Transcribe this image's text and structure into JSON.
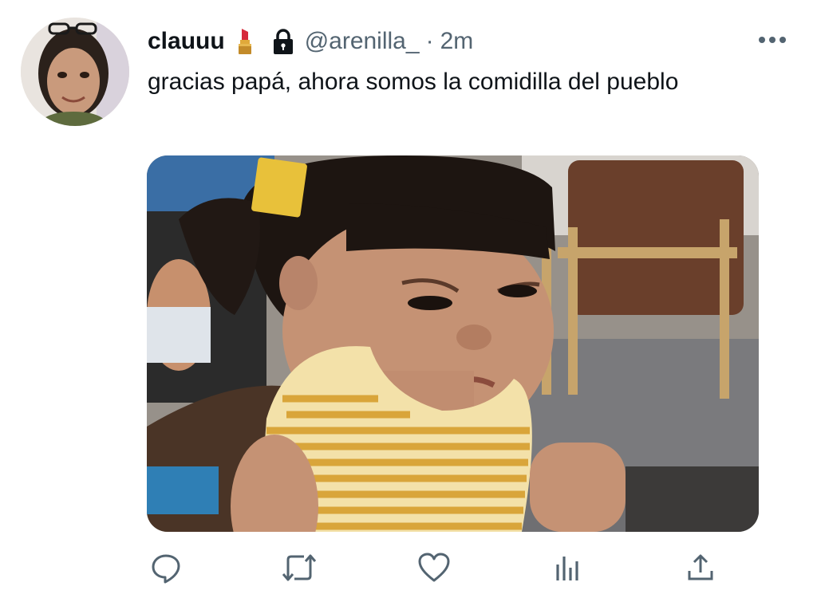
{
  "tweet": {
    "display_name": "clauuu",
    "name_emoji": "lipstick-icon",
    "protected_icon": "lock-icon",
    "handle": "@arenilla_",
    "separator": "·",
    "time": "2m",
    "text": "gracias papá, ahora somos la comidilla del pueblo",
    "more_icon": "more-icon"
  },
  "actions": [
    {
      "name": "reply",
      "icon": "reply-icon"
    },
    {
      "name": "retweet",
      "icon": "retweet-icon"
    },
    {
      "name": "like",
      "icon": "heart-icon"
    },
    {
      "name": "analytics",
      "icon": "analytics-icon"
    },
    {
      "name": "share",
      "icon": "share-icon"
    }
  ],
  "colors": {
    "text_primary": "#0f1419",
    "text_secondary": "#536471",
    "icon": "#536471",
    "background": "#ffffff"
  }
}
